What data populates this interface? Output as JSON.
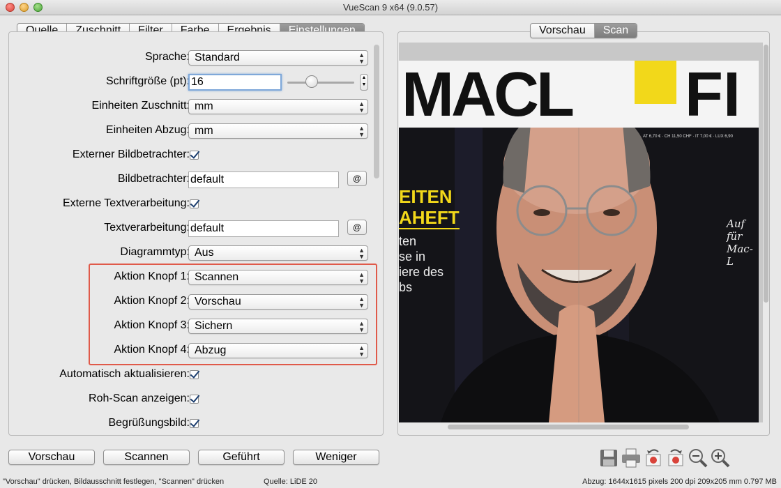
{
  "window": {
    "title": "VueScan 9 x64 (9.0.57)"
  },
  "left_tabs": [
    "Quelle",
    "Zuschnitt",
    "Filter",
    "Farbe",
    "Ergebnis",
    "Einstellungen"
  ],
  "left_tabs_active": "Einstellungen",
  "right_tabs": [
    "Vorschau",
    "Scan"
  ],
  "right_tabs_active": "Scan",
  "settings": {
    "sprache": {
      "label": "Sprache:",
      "value": "Standard"
    },
    "schriftgroesse": {
      "label": "Schriftgröße (pt):",
      "value": "16"
    },
    "einheiten_zuschnitt": {
      "label": "Einheiten Zuschnitt:",
      "value": "mm"
    },
    "einheiten_abzug": {
      "label": "Einheiten Abzug:",
      "value": "mm"
    },
    "externer_bildbetrachter": {
      "label": "Externer Bildbetrachter:",
      "checked": true
    },
    "bildbetrachter": {
      "label": "Bildbetrachter:",
      "value": "default",
      "button": "@"
    },
    "externe_textverarbeitung": {
      "label": "Externe Textverarbeitung:",
      "checked": true
    },
    "textverarbeitung": {
      "label": "Textverarbeitung:",
      "value": "default",
      "button": "@"
    },
    "diagrammtyp": {
      "label": "Diagrammtyp:",
      "value": "Aus"
    },
    "aktion_knopf_1": {
      "label": "Aktion Knopf 1:",
      "value": "Scannen"
    },
    "aktion_knopf_2": {
      "label": "Aktion Knopf 2:",
      "value": "Vorschau"
    },
    "aktion_knopf_3": {
      "label": "Aktion Knopf 3:",
      "value": "Sichern"
    },
    "aktion_knopf_4": {
      "label": "Aktion Knopf 4:",
      "value": "Abzug"
    },
    "automatisch_aktualisieren": {
      "label": "Automatisch aktualisieren:",
      "checked": true
    },
    "roh_scan_anzeigen": {
      "label": "Roh-Scan anzeigen:",
      "checked": true
    },
    "begruessungsbild": {
      "label": "Begrüßungsbild:",
      "checked": true
    }
  },
  "preview": {
    "magazine_title": "MACL",
    "magazine_title_right": "FI",
    "cover_line_1": "EITEN",
    "cover_line_2": "AHEFT",
    "cover_text_1": "ten",
    "cover_text_2": "se in",
    "cover_text_3": "iere des",
    "cover_text_4": "bs",
    "price_text": "AT 6,70 € · CH 11,50 CHF · IT 7,00 € · LUX 6,90",
    "handwritten_1": "Auf",
    "handwritten_2": "für",
    "handwritten_3": "Mac-L"
  },
  "bottom_buttons": {
    "vorschau": "Vorschau",
    "scannen": "Scannen",
    "gefuehrt": "Geführt",
    "weniger": "Weniger"
  },
  "toolbar_icons": [
    "save-icon",
    "print-icon",
    "rotate-left-icon",
    "rotate-right-icon",
    "zoom-out-icon",
    "zoom-in-icon"
  ],
  "status": {
    "hint": "\"Vorschau\" drücken, Bildausschnitt festlegen, \"Scannen\" drücken",
    "source": "Quelle: LiDE 20",
    "output": "Abzug: 1644x1615 pixels 200 dpi 209x205 mm 0.797 MB"
  },
  "colors": {
    "highlight": "#e05a4a",
    "focus_ring": "#7fa8d9",
    "active_tab": "#8a8a8a",
    "magazine_yellow": "#f2d81a"
  }
}
